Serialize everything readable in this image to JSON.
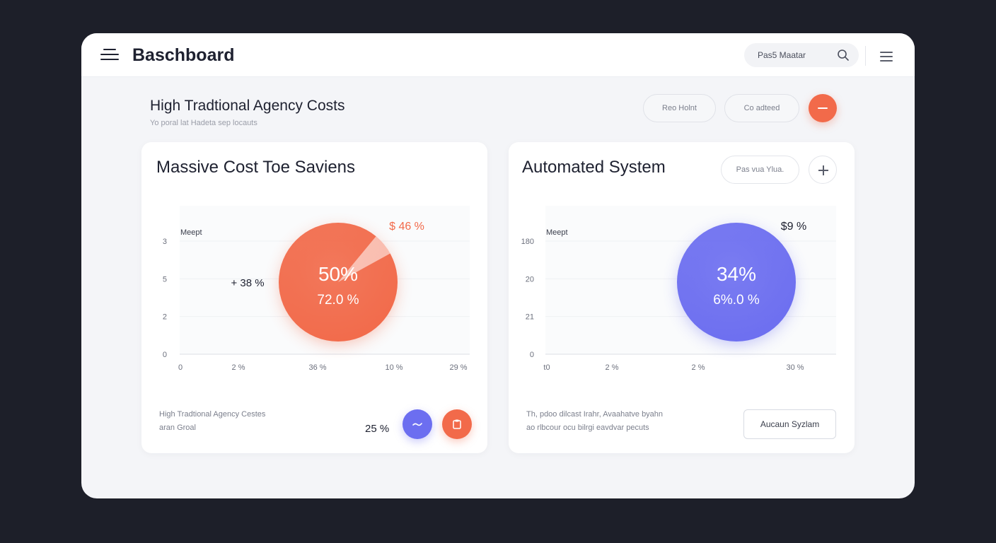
{
  "app": {
    "title": "Baschboard"
  },
  "search": {
    "text": "Pas5 Maatar"
  },
  "header": {
    "title": "High Tradtional Agency Costs",
    "subtitle": "Yo poral lat Hadeta sep locauts",
    "buttons": [
      {
        "label": "Reo Holnt"
      },
      {
        "label": "Co adteed"
      }
    ]
  },
  "cards": [
    {
      "title": "Massive Cost Toe Saviens",
      "footer_lines": [
        "High Tradtional Agency Cestes",
        "aran Groal"
      ],
      "footer_value": "25 %"
    },
    {
      "title": "Automated System",
      "pill_label": "Pas vua Ylua.",
      "footer_lines": [
        "Th, pdoo dilcast Irahr, Avaahatve byahn",
        "ao rlbcour ocu bilrgi eavdvar pecuts"
      ],
      "button_label": "Aucaun Syzlam"
    }
  ],
  "chart_data": [
    {
      "type": "scatter",
      "title": "Massive Cost Toe Saviens",
      "series_label": "Meept",
      "color": "#f26a4a",
      "y_ticks": [
        "0",
        "2",
        "5",
        "3"
      ],
      "x_ticks": [
        "0",
        "2 %",
        "36 %",
        "10 %",
        "29 %"
      ],
      "bubble": {
        "value_text": "50%",
        "sub_text": "72.0 %",
        "highlight_fraction": 0.06
      },
      "annotations": [
        {
          "text": "$ 46 %",
          "color": "#f26a4a"
        },
        {
          "text": "+ 38 %",
          "color": "#1e2130"
        }
      ]
    },
    {
      "type": "scatter",
      "title": "Automated System",
      "series_label": "Meept",
      "color": "#6c6ef0",
      "y_ticks": [
        "0",
        "21",
        "20",
        "180"
      ],
      "x_ticks": [
        "t0",
        "2 %",
        "2 %",
        "30 %"
      ],
      "bubble": {
        "value_text": "34%",
        "sub_text": "6%.0 %"
      },
      "annotations": [
        {
          "text": "$9 %",
          "color": "#1e2130"
        }
      ]
    }
  ]
}
